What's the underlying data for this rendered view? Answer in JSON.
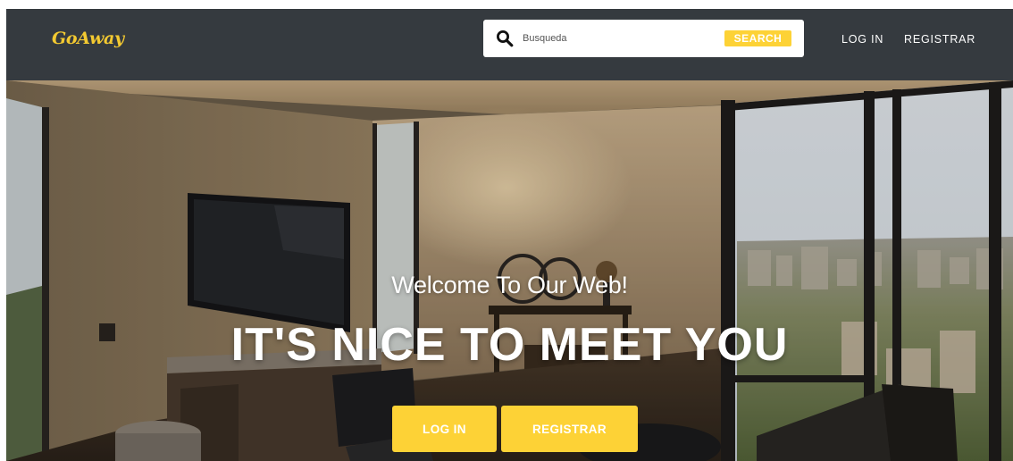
{
  "navbar": {
    "brand": "GoAway",
    "search": {
      "placeholder": "Busqueda",
      "value": "",
      "button_label": "SEARCH",
      "icon": "search-icon"
    },
    "links": {
      "login": "LOG IN",
      "register": "REGISTRAR"
    }
  },
  "hero": {
    "subtitle": "Welcome To Our Web!",
    "title": "IT'S NICE TO MEET YOU",
    "buttons": {
      "login": "LOG IN",
      "register": "REGISTRAR"
    }
  },
  "colors": {
    "navbar_bg": "#353a3f",
    "brand": "#f3c931",
    "accent": "#fdd236",
    "text_light": "#ffffff"
  }
}
